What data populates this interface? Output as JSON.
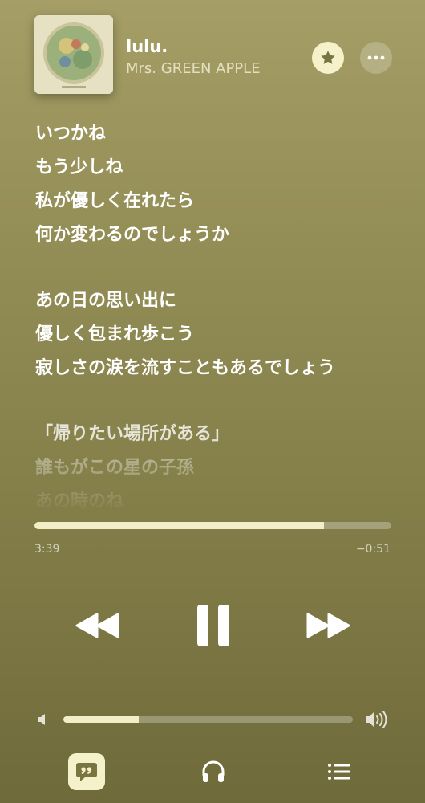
{
  "track": {
    "title": "lulu.",
    "artist": "Mrs. GREEN APPLE",
    "artwork_icon": "album-art"
  },
  "header": {
    "favorite_icon": "star-icon",
    "more_icon": "ellipsis-icon"
  },
  "lyrics": {
    "groups": [
      {
        "lines": [
          "いつかね",
          "もう少しね",
          "私が優しく在れたら",
          "何か変わるのでしょうか"
        ]
      },
      {
        "lines": [
          "あの日の思い出に",
          "優しく包まれ歩こう",
          "寂しさの涙を流すこともあるでしょう"
        ]
      },
      {
        "lines": [
          "「帰りたい場所がある」",
          "誰もがこの星の子孫",
          "あの時のね"
        ]
      }
    ]
  },
  "playback": {
    "elapsed": "3:39",
    "remaining": "−0:51",
    "progress": 0.811,
    "state": "playing"
  },
  "controls": {
    "rewind_icon": "rewind-icon",
    "pause_icon": "pause-icon",
    "forward_icon": "fast-forward-icon"
  },
  "volume": {
    "level": 0.26,
    "low_icon": "speaker-low-icon",
    "high_icon": "speaker-high-icon"
  },
  "tabs": [
    {
      "icon": "lyrics-quote-icon",
      "active": true
    },
    {
      "icon": "airplay-headphones-icon",
      "active": false
    },
    {
      "icon": "queue-list-icon",
      "active": false
    }
  ],
  "colors": {
    "accent": "#f5f1cb",
    "background_top": "#a59e66",
    "background_bottom": "#6f6a3a"
  }
}
